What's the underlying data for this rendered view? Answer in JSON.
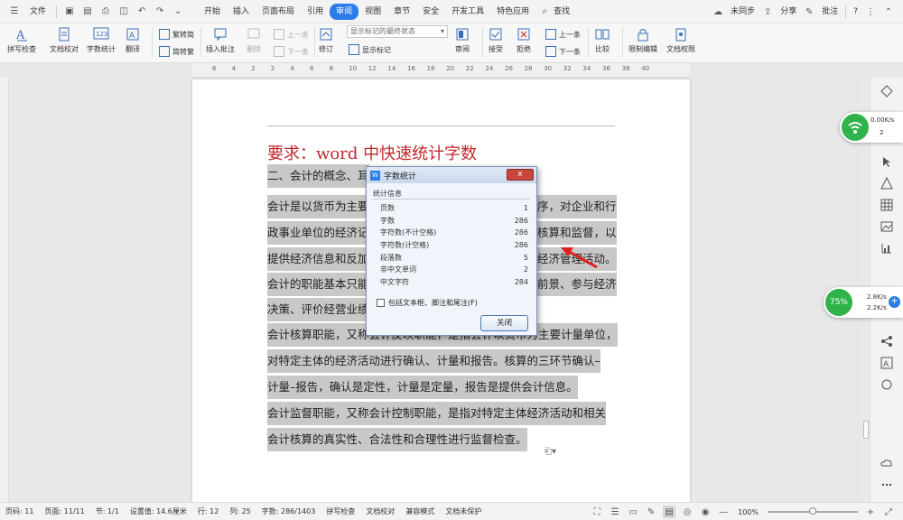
{
  "menubar": {
    "file": "文件",
    "tabs": [
      "开始",
      "插入",
      "页面布局",
      "引用",
      "审阅",
      "视图",
      "章节",
      "安全",
      "开发工具",
      "特色应用"
    ],
    "active_tab": "审阅",
    "search": "查找",
    "right": {
      "sync": "未同步",
      "share": "分享",
      "comment": "批注",
      "help": "?"
    }
  },
  "ribbon": {
    "spell_check": "拼写检查",
    "doc_proof": "文档校对",
    "word_count": "字数统计",
    "translate": "翻译",
    "to_traditional": "繁转简",
    "to_simplified": "简转繁",
    "insert_comment": "插入批注",
    "delete": "删除",
    "prev": "上一条",
    "next": "下一条",
    "show_final": "显示标记的最终状态",
    "show_markup": "显示标记",
    "track": "修订",
    "review": "审阅",
    "accept": "接受",
    "reject": "拒绝",
    "prev2": "上一条",
    "next2": "下一条",
    "compare": "比较",
    "restrict": "限制编辑",
    "permission": "文档权限"
  },
  "ruler": {
    "ticks": [
      "6",
      "4",
      "2",
      "2",
      "4",
      "6",
      "8",
      "10",
      "12",
      "14",
      "16",
      "18",
      "20",
      "22",
      "24",
      "26",
      "28",
      "30",
      "32",
      "34",
      "36",
      "38",
      "40"
    ]
  },
  "document": {
    "title": "要求：word 中快速统计字数",
    "lines": [
      "二、会计的概念、职能",
      "会计是以货币为主要计量单位，采用专门的方法和程序，对企业和行",
      "政事业单位的经济活动进行完整的、连续的、系统的核算和监督，以",
      "提供经济信息和反映受托责任履行情况为主要目的的经济管理活动。",
      "会计的职能基本只能有：核算职能和监督职能，拓展：预测经济前景、参与经济",
      "决策、评价经营业绩",
      "会计核算职能，又称会计反映职能，是指会计以货币为主要计量单位，",
      "对特定主体的经济活动进行确认、计量和报告。核算的三环节确认–",
      "计量–报告，确认是定性，计量是定量，报告是提供会计信息。",
      "会计监督职能，又称会计控制职能，是指对特定主体经济活动和相关",
      "会计核算的真实性、合法性和合理性进行监督检查。"
    ],
    "visible_left": [
      "二、会计的概念、耳",
      "会计是以货币为主要",
      "政事业单位的经济记",
      "提供经济信息和反加",
      "会计的职能基本只能",
      "决策、评价经营业绩",
      "会计核算职能，又称会计反映职能，是指会计以货币为主要计量单位，",
      "对特定主体的经济活动进行确认、计量和报告。核算的三环节确认–",
      "计量–报告，确认是定性，计量是定量，报告是提供会计信息。",
      "会计监督职能，又称会计控制职能，是指对特定主体经济活动和相关",
      "会计核算的真实性、合法性和合理性进行监督检查。"
    ],
    "visible_right": [
      "",
      "序，对企业和行",
      "核算和监督，以",
      "经济管理活动。",
      "前景、参与经济",
      "",
      "",
      "",
      "",
      "",
      ""
    ]
  },
  "dialog": {
    "title": "字数统计",
    "close_x": "x",
    "group_label": "统计信息",
    "rows": [
      {
        "label": "页数",
        "value": "1"
      },
      {
        "label": "字数",
        "value": "286"
      },
      {
        "label": "字符数(不计空格)",
        "value": "286"
      },
      {
        "label": "字符数(计空格)",
        "value": "286"
      },
      {
        "label": "段落数",
        "value": "5"
      },
      {
        "label": "非中文单词",
        "value": "2"
      },
      {
        "label": "中文字符",
        "value": "284"
      }
    ],
    "checkbox_label": "包括文本框、脚注和尾注(F)",
    "close_button": "关闭"
  },
  "statusbar": {
    "page_code": "页码: 11",
    "pages": "页面: 11/11",
    "section": "节: 1/1",
    "setting": "设置值: 14.6厘米",
    "row": "行: 12",
    "col": "列: 25",
    "words": "字数: 286/1403",
    "spell": "拼写检查",
    "proof": "文档校对",
    "compat": "兼容模式",
    "unprotected": "文档未保护",
    "zoom": "100%"
  },
  "net_widget_top": {
    "speed": "0.00K/s",
    "count": "2"
  },
  "net_widget_bottom": {
    "percent": "75%",
    "up": "2.8K/s",
    "down": "2.2K/s"
  },
  "colors": {
    "accent": "#2b7de9",
    "title_red": "#c0282d",
    "highlight": "#c8c8c8",
    "green": "#2fb34a"
  }
}
